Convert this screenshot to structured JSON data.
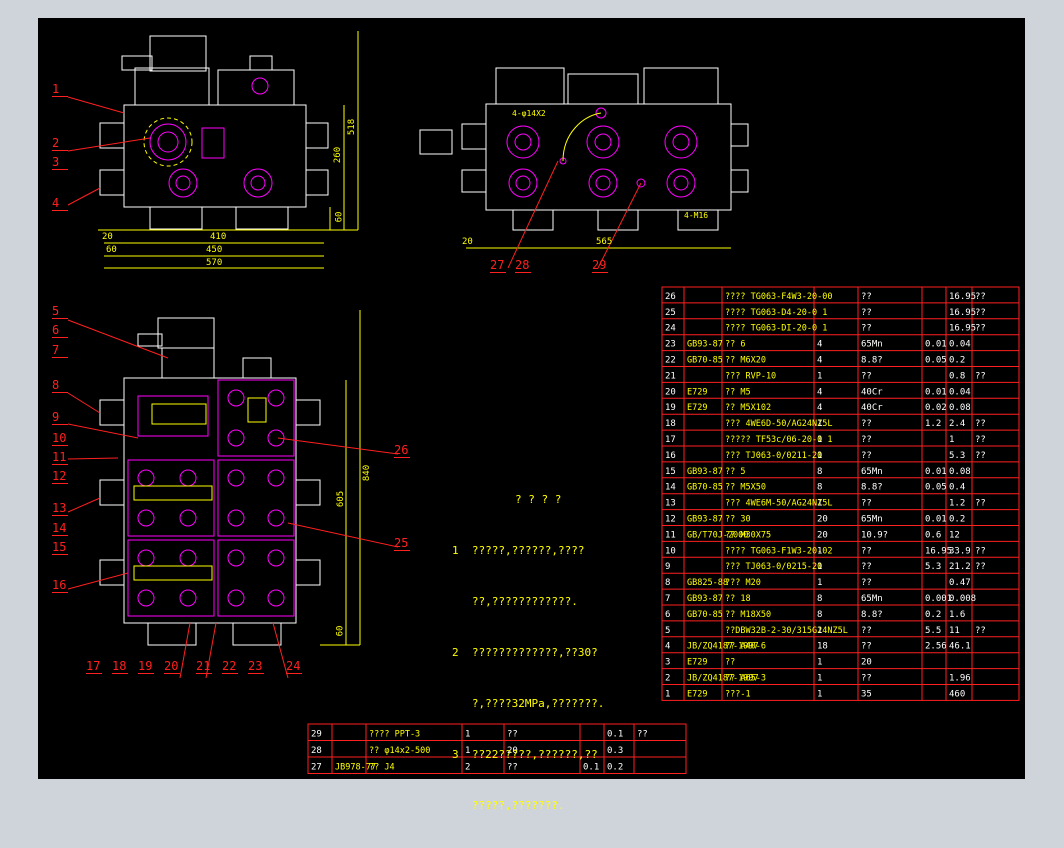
{
  "colors": {
    "bg": "#000000",
    "frame": "#cfd3da",
    "part": "#ffffff",
    "dim": "#ffff00",
    "hole": "#ff00ff",
    "leader": "#ff2020",
    "table": "#ff2020",
    "table_text": "#ffffff"
  },
  "view1": {
    "dims": {
      "w410": "410",
      "w450": "450",
      "w570": "570",
      "h518": "518",
      "h260": "260",
      "h60": "60",
      "d20": "20",
      "d60": "60"
    },
    "balloons": [
      "1",
      "2",
      "3",
      "4"
    ]
  },
  "view2": {
    "dims": {
      "w565": "565",
      "d20": "20",
      "phi": "4-φ14X2",
      "thread": "4-M16"
    },
    "balloons": [
      "27",
      "28",
      "29"
    ]
  },
  "view3": {
    "dims": {
      "h840": "840",
      "h605": "605",
      "h60": "60"
    },
    "balloons_left": [
      "5",
      "6",
      "7",
      "8",
      "9",
      "10",
      "11",
      "12",
      "13",
      "14",
      "15",
      "16"
    ],
    "balloons_bottom": [
      "17",
      "18",
      "19",
      "20",
      "21",
      "22",
      "23",
      "24"
    ],
    "balloons_right": [
      "25",
      "26"
    ],
    "small_labels": [
      "9",
      "2",
      "3",
      "4",
      "1"
    ]
  },
  "notes": {
    "title": "? ? ? ?",
    "lines": [
      "1  ?????,??????,????",
      "   ??,????????????.",
      "2  ?????????????,??30?",
      "   ?,????32MPa,???????.",
      "3  ??22?????,??????,??",
      "   ?????,???????."
    ]
  },
  "bom": [
    [
      "26",
      "",
      "???? TG063-F4W3-20-00",
      "",
      "??",
      "",
      "16.95",
      "??"
    ],
    [
      "25",
      "",
      "???? TG063-D4-20-0 1",
      "",
      "??",
      "",
      "16.95",
      "??"
    ],
    [
      "24",
      "",
      "???? TG063-DI-20-0 1",
      "",
      "??",
      "",
      "16.95",
      "??"
    ],
    [
      "23",
      "GB93-87",
      "?? 6",
      "4",
      "65Mn",
      "0.01",
      "0.04",
      ""
    ],
    [
      "22",
      "GB70-85",
      "?? M6X20",
      "4",
      "8.8?",
      "0.05",
      "0.2",
      ""
    ],
    [
      "21",
      "",
      "??? RVP-10",
      "1",
      "??",
      "",
      "0.8",
      "??"
    ],
    [
      "20",
      "E729",
      "?? M5",
      "4",
      "40Cr",
      "0.01",
      "0.04",
      ""
    ],
    [
      "19",
      "E729",
      "?? M5X102",
      "4",
      "40Cr",
      "0.02",
      "0.08",
      ""
    ],
    [
      "18",
      "",
      "??? 4WE6D-50/AG24NZ5L",
      "1",
      "??",
      "1.2",
      "2.4",
      "??"
    ],
    [
      "17",
      "",
      "????? TF53c/06-20-0 1",
      "1",
      "??",
      "",
      "1",
      "??"
    ],
    [
      "16",
      "",
      "??? TJ063-0/0211-20",
      "1",
      "??",
      "",
      "5.3",
      "??"
    ],
    [
      "15",
      "GB93-87",
      "?? 5",
      "8",
      "65Mn",
      "0.01",
      "0.08",
      ""
    ],
    [
      "14",
      "GB70-85",
      "?? M5X50",
      "8",
      "8.8?",
      "0.05",
      "0.4",
      ""
    ],
    [
      "13",
      "",
      "??? 4WE6M-50/AG24NZ5L",
      "1",
      "??",
      "",
      "1.2",
      "??"
    ],
    [
      "12",
      "GB93-87",
      "?? 30",
      "20",
      "65Mn",
      "0.01",
      "0.2",
      ""
    ],
    [
      "11",
      "GB/T70J-2000",
      "?? M30X75",
      "20",
      "10.9?",
      "0.6",
      "12",
      ""
    ],
    [
      "10",
      "",
      "???? TG063-F1W3-20-02",
      "1",
      "??",
      "16.95",
      "33.9",
      "??"
    ],
    [
      "9",
      "",
      "??? TJ063-0/0215-20",
      "1",
      "??",
      "5.3",
      "21.2",
      "??"
    ],
    [
      "8",
      "GB825-88",
      "??? M20",
      "1",
      "??",
      "",
      "0.47",
      ""
    ],
    [
      "7",
      "GB93-87",
      "?? 18",
      "8",
      "65Mn",
      "0.001",
      "0.008",
      ""
    ],
    [
      "6",
      "GB70-85",
      "?? M18X50",
      "8",
      "8.8?",
      "0.2",
      "1.6",
      ""
    ],
    [
      "5",
      "",
      "??DBW32B-2-30/315G24NZ5L",
      "1",
      "??",
      "5.5",
      "11",
      "??"
    ],
    [
      "4",
      "JB/ZQ4187-1997",
      "?? A40-6",
      "18",
      "??",
      "2.56",
      "46.1",
      ""
    ],
    [
      "3",
      "E729",
      "??",
      "1",
      "20",
      "",
      "",
      ""
    ],
    [
      "2",
      "JB/ZQ4187-1997",
      "?? A65-3",
      "1",
      "??",
      "",
      "1.96",
      ""
    ],
    [
      "1",
      "E729",
      "???-1",
      "1",
      "35",
      "",
      "460",
      ""
    ]
  ],
  "bom2": [
    [
      "29",
      "",
      "???? PPT-3",
      "1",
      "??",
      "",
      "0.1",
      "??"
    ],
    [
      "28",
      "",
      "?? φ14x2-500",
      "1",
      "20",
      "",
      "0.3",
      ""
    ],
    [
      "27",
      "JB978-77",
      "?? J4",
      "2",
      "??",
      "0.1",
      "0.2",
      ""
    ]
  ]
}
